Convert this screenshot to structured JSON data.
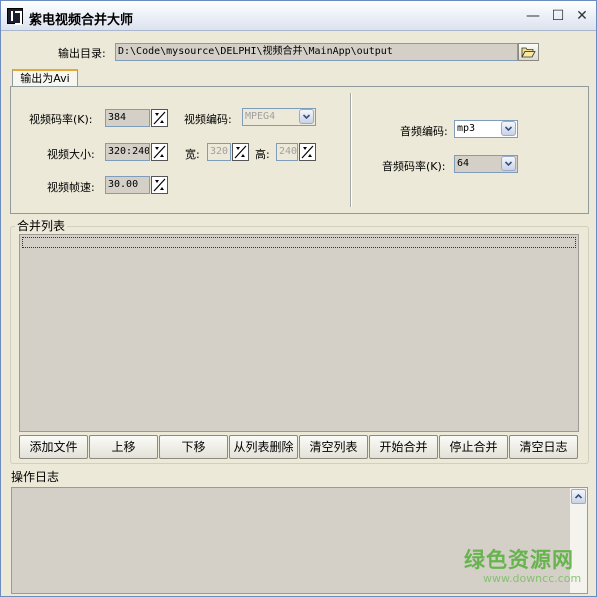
{
  "window": {
    "title": "紫电视频合并大师",
    "minimize": "—",
    "maximize": "☐",
    "close": "✕"
  },
  "output": {
    "label": "输出目录:",
    "path": "D:\\Code\\mysource\\DELPHI\\视频合并\\MainApp\\output"
  },
  "tab": {
    "label": "输出为Avi"
  },
  "video": {
    "bitrate_label": "视频码率(K):",
    "bitrate_value": "384",
    "codec_label": "视频编码:",
    "codec_value": "MPEG4",
    "size_label": "视频大小:",
    "size_value": "320:240",
    "width_label": "宽:",
    "width_value": "320",
    "height_label": "高:",
    "height_value": "240",
    "fps_label": "视频帧速:",
    "fps_value": "30.00"
  },
  "audio": {
    "codec_label": "音频编码:",
    "codec_value": "mp3",
    "bitrate_label": "音频码率(K):",
    "bitrate_value": "64"
  },
  "merge_list": {
    "title": "合并列表"
  },
  "buttons": {
    "add_file": "添加文件",
    "move_up": "上移",
    "move_down": "下移",
    "remove_from_list": "从列表删除",
    "clear_list": "清空列表",
    "start_merge": "开始合并",
    "stop_merge": "停止合并",
    "clear_log": "清空日志"
  },
  "log": {
    "title": "操作日志"
  },
  "watermark": {
    "name": "绿色资源网",
    "url": "www.downcc.com",
    "color": "#55b03a"
  }
}
